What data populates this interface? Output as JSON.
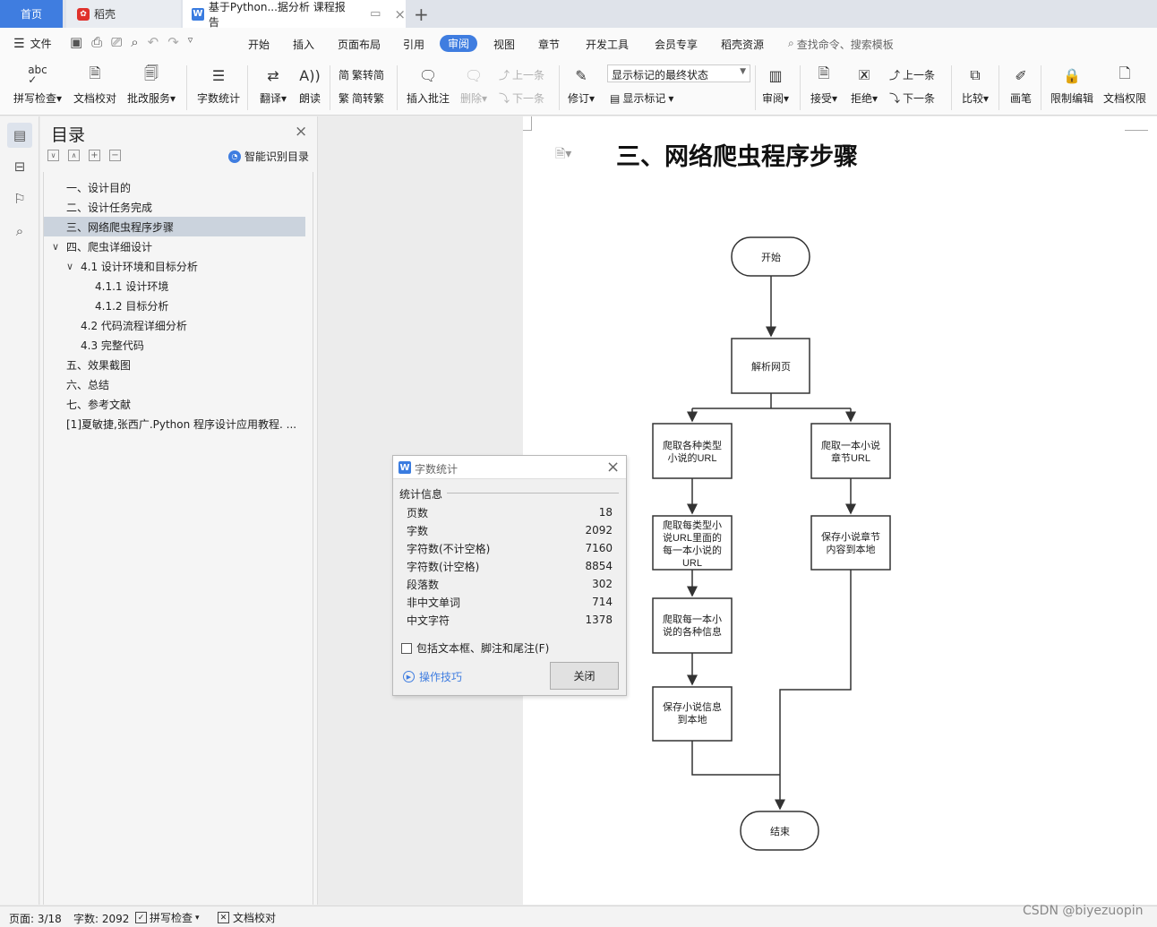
{
  "tabs": {
    "home": "首页",
    "daoke": "稻壳",
    "doc": "基于Python...据分析 课程报告"
  },
  "menu": {
    "file": "文件",
    "items": [
      "开始",
      "插入",
      "页面布局",
      "引用",
      "审阅",
      "视图",
      "章节",
      "开发工具",
      "会员专享",
      "稻壳资源"
    ],
    "search": "查找命令、搜索模板"
  },
  "ribbon": {
    "spellcheck": "拼写检查",
    "doc_proof": "文档校对",
    "review_service": "批改服务",
    "word_count": "字数统计",
    "translate": "翻译",
    "read_aloud": "朗读",
    "trad_to_simp": "繁转简",
    "simp_to_trad": "简转繁",
    "insert_comment": "插入批注",
    "delete": "删除",
    "prev_item": "上一条",
    "next_item": "下一条",
    "track_changes": "修订",
    "display_state": "显示标记的最终状态",
    "show_markup": "显示标记",
    "review": "审阅",
    "accept": "接受",
    "reject": "拒绝",
    "prev_change": "上一条",
    "next_change": "下一条",
    "compare": "比较",
    "pen": "画笔",
    "restrict_edit": "限制编辑",
    "doc_rights": "文档权限"
  },
  "toc": {
    "title": "目录",
    "smart": "智能识别目录",
    "items": [
      {
        "label": "一、设计目的",
        "level": 1
      },
      {
        "label": "二、设计任务完成",
        "level": 1
      },
      {
        "label": "三、网络爬虫程序步骤",
        "level": 1,
        "selected": true
      },
      {
        "label": "四、爬虫详细设计",
        "level": 1,
        "expanded": true
      },
      {
        "label": "4.1 设计环境和目标分析",
        "level": 2,
        "expanded": true
      },
      {
        "label": "4.1.1 设计环境",
        "level": 3
      },
      {
        "label": "4.1.2 目标分析",
        "level": 3
      },
      {
        "label": "4.2 代码流程详细分析",
        "level": 2
      },
      {
        "label": "4.3 完整代码",
        "level": 2
      },
      {
        "label": "五、效果截图",
        "level": 1
      },
      {
        "label": "六、总结",
        "level": 1
      },
      {
        "label": "七、参考文献",
        "level": 1
      },
      {
        "label": "[1]夏敏捷,张西广.Python 程序设计应用教程. ...",
        "level": 1
      }
    ]
  },
  "document": {
    "heading": "三、网络爬虫程序步骤",
    "flow": {
      "start": "开始",
      "parse": "解析网页",
      "left1": [
        "爬取各种类型",
        "小说的URL"
      ],
      "left2": [
        "爬取每类型小",
        "说URL里面的",
        "每一本小说的",
        "URL"
      ],
      "left3": [
        "爬取每一本小",
        "说的各种信息"
      ],
      "left4": [
        "保存小说信息",
        "到本地"
      ],
      "right1": [
        "爬取一本小说",
        "章节URL"
      ],
      "right2": [
        "保存小说章节",
        "内容到本地"
      ],
      "end": "结束"
    }
  },
  "dialog": {
    "title": "字数统计",
    "section": "统计信息",
    "stats": [
      {
        "label": "页数",
        "value": "18"
      },
      {
        "label": "字数",
        "value": "2092"
      },
      {
        "label": "字符数(不计空格)",
        "value": "7160"
      },
      {
        "label": "字符数(计空格)",
        "value": "8854"
      },
      {
        "label": "段落数",
        "value": "302"
      },
      {
        "label": "非中文单词",
        "value": "714"
      },
      {
        "label": "中文字符",
        "value": "1378"
      }
    ],
    "checkbox": "包括文本框、脚注和尾注(F)",
    "tips": "操作技巧",
    "close": "关闭"
  },
  "status": {
    "page": "页面: 3/18",
    "words": "字数: 2092",
    "spell": "拼写检查",
    "proof": "文档校对"
  },
  "watermark": "CSDN @biyezuopin"
}
